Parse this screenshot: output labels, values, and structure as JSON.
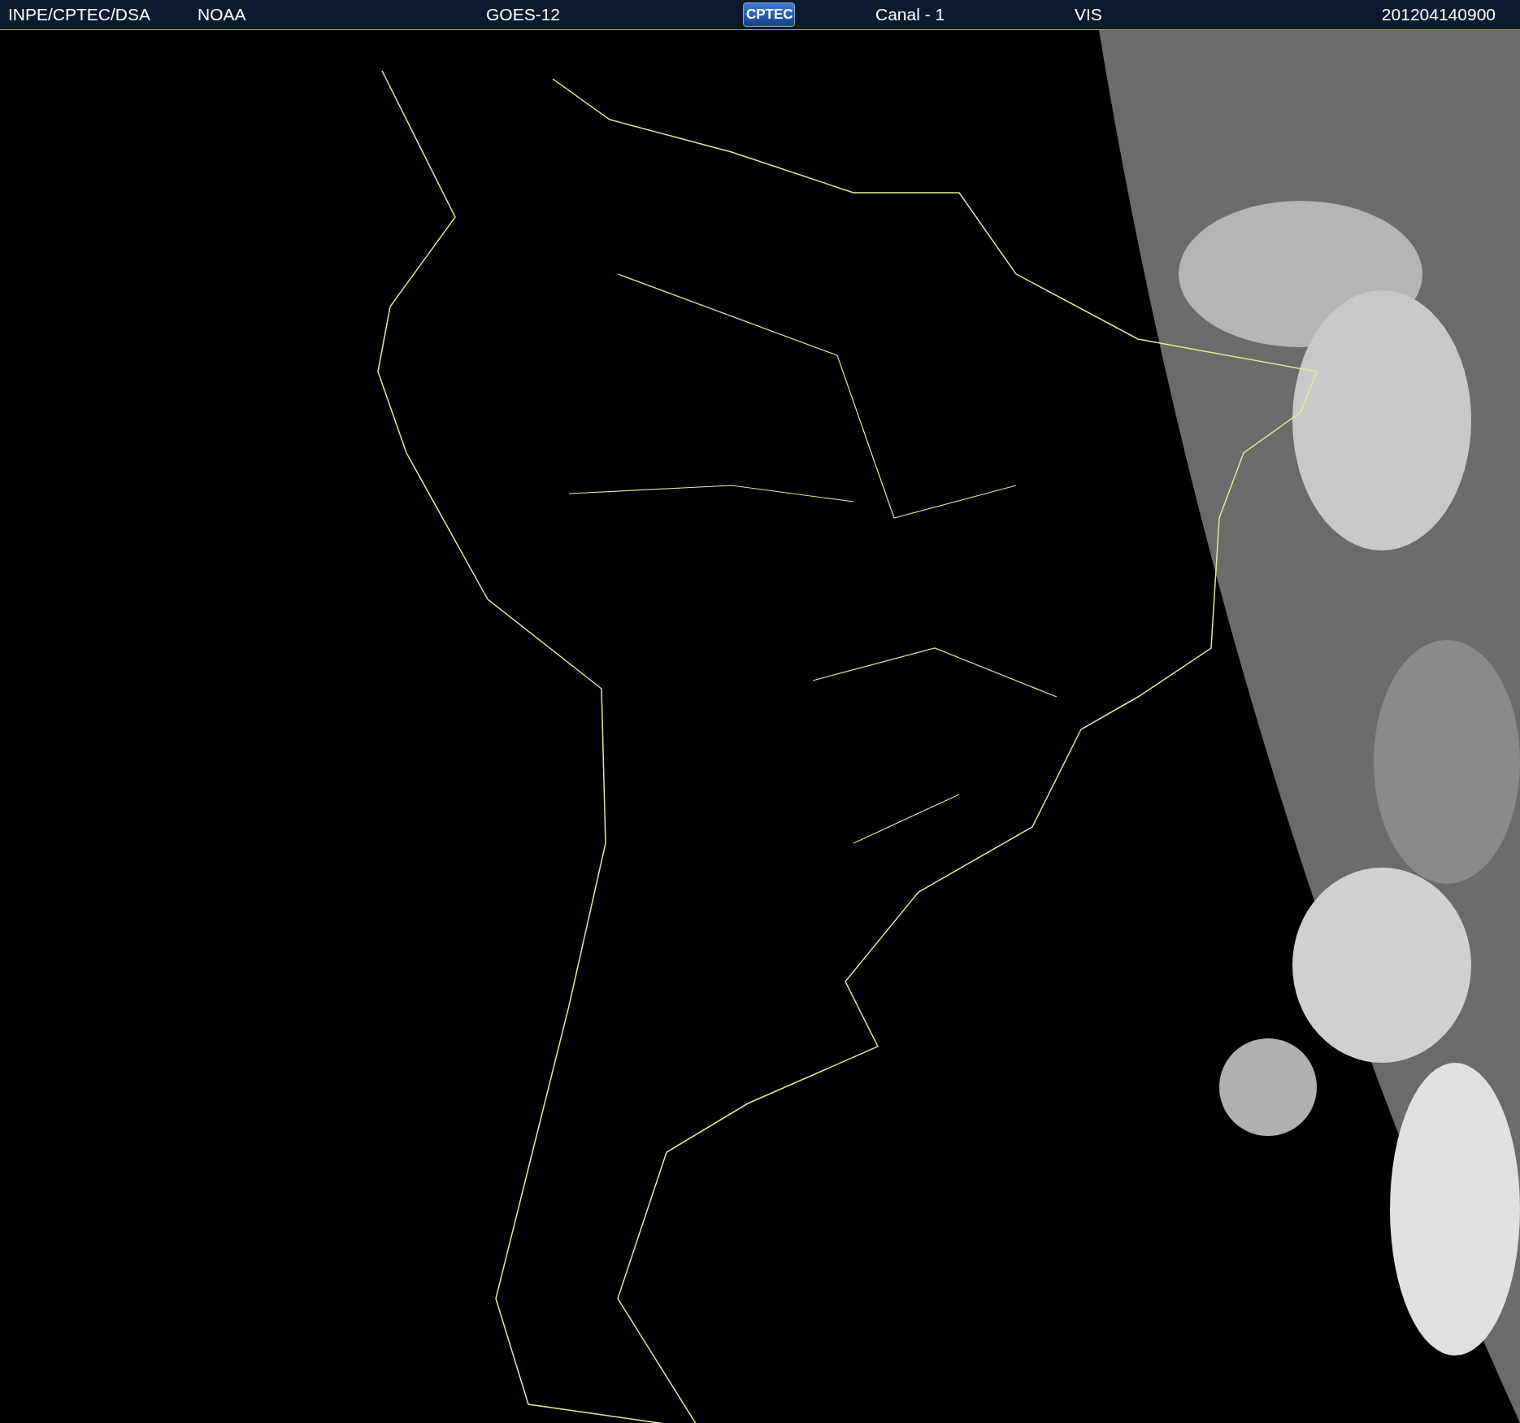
{
  "header": {
    "items": [
      {
        "kind": "text",
        "text": "INPE/CPTEC/DSA"
      },
      {
        "kind": "text",
        "text": "NOAA"
      },
      {
        "kind": "text",
        "text": "GOES-12"
      },
      {
        "kind": "logo",
        "text": "CPTEC"
      },
      {
        "kind": "text",
        "text": "Canal - 1"
      },
      {
        "kind": "text",
        "text": "VIS"
      },
      {
        "kind": "text",
        "text": "201204140900"
      }
    ]
  }
}
